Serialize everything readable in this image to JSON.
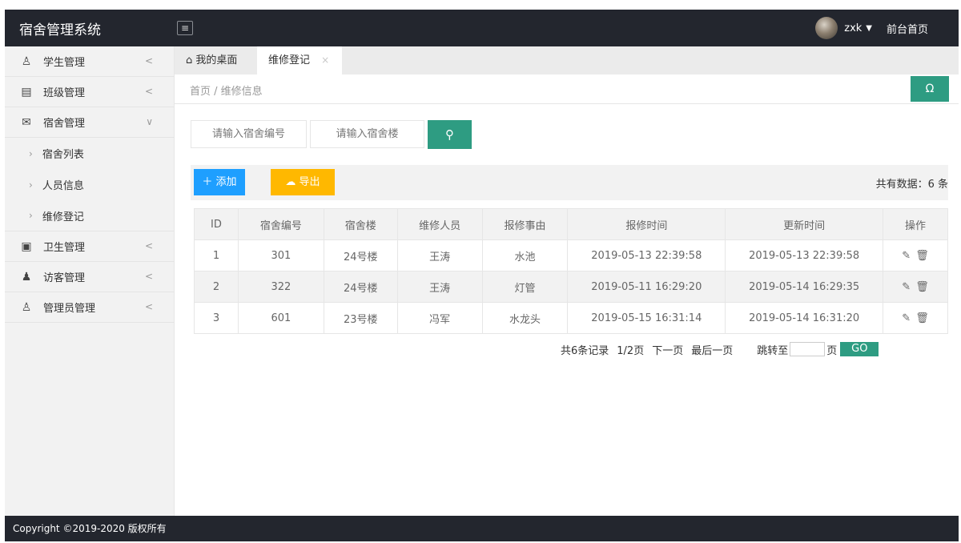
{
  "app": {
    "title": "宿舍管理系统"
  },
  "header": {
    "menu_toggle_icon": "≡",
    "username": "zxk",
    "front_link": "前台首页"
  },
  "sidebar": {
    "items": [
      {
        "icon": "user-icon",
        "glyph": "♙",
        "label": "学生管理",
        "chevron": "<"
      },
      {
        "icon": "class-icon",
        "glyph": "▤",
        "label": "班级管理",
        "chevron": "<"
      },
      {
        "icon": "dorm-icon",
        "glyph": "✉",
        "label": "宿舍管理",
        "chevron": "∨"
      },
      {
        "icon": "health-icon",
        "glyph": "▣",
        "label": "卫生管理",
        "chevron": "<"
      },
      {
        "icon": "visitors-icon",
        "glyph": "♟",
        "label": "访客管理",
        "chevron": "<"
      },
      {
        "icon": "admin-icon",
        "glyph": "♙",
        "label": "管理员管理",
        "chevron": "<"
      }
    ],
    "subitems": [
      {
        "label": "宿舍列表"
      },
      {
        "label": "人员信息"
      },
      {
        "label": "维修登记"
      }
    ]
  },
  "tabs": {
    "home": "我的桌面",
    "current": "维修登记",
    "close": "×"
  },
  "breadcrumb": "首页 / 维修信息",
  "refresh_icon": "Ω",
  "search": {
    "dorm_number_placeholder": "请输入宿舍编号",
    "dorm_building_placeholder": "请输入宿舍楼"
  },
  "toolbar": {
    "add_label": "＋ 添加",
    "export_label": "☁ 导出",
    "total_text": "共有数据：6 条"
  },
  "table": {
    "columns": [
      "ID",
      "宿舍编号",
      "宿舍楼",
      "维修人员",
      "报修事由",
      "报修时间",
      "更新时间",
      "操作"
    ],
    "rows": [
      [
        "1",
        "301",
        "24号楼",
        "王涛",
        "水池",
        "2019-05-13 22:39:58",
        "2019-05-13 22:39:58"
      ],
      [
        "2",
        "322",
        "24号楼",
        "王涛",
        "灯管",
        "2019-05-11 16:29:20",
        "2019-05-14 16:29:35"
      ],
      [
        "3",
        "601",
        "23号楼",
        "冯军",
        "水龙头",
        "2019-05-15 16:31:14",
        "2019-05-14 16:31:20"
      ]
    ],
    "edit_glyph": "✎",
    "delete_glyph": "🗑"
  },
  "pager": {
    "records": "共6条记录",
    "page_info": "1/2页",
    "next": "下一页",
    "last": "最后一页",
    "jump_to": "跳转至",
    "page_unit": "页",
    "go": "GO"
  },
  "footer": "Copyright ©2019-2020 版权所有",
  "colors": {
    "header_bg": "#23262e",
    "primary_green": "#2e9c82",
    "add_blue": "#1e9fff",
    "export_orange": "#ffb800"
  }
}
